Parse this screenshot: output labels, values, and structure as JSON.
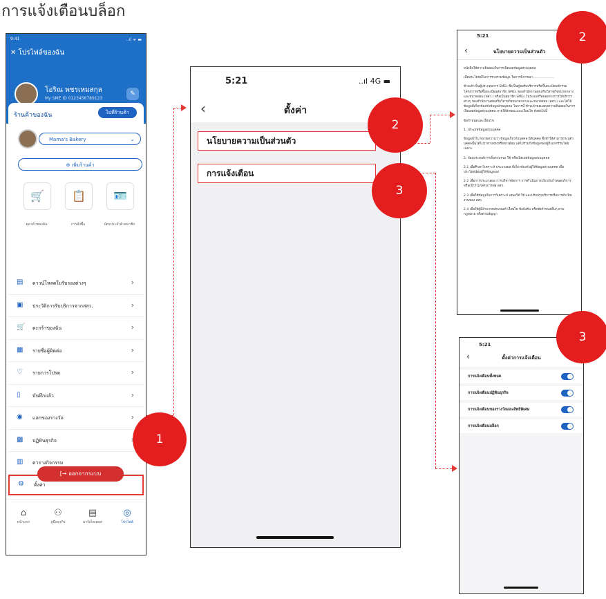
{
  "heading": "การแจ้งเตือนบล็อก",
  "screen1": {
    "status_time": "9:41",
    "status_right": "..ıl ᯤ ▬",
    "header": "✕ โปรไฟล์ของฉัน",
    "user_name": "โอริณ พชรเหมสกุล",
    "user_id": "My SME ID 0123456789123",
    "shop_section": "ร้านค้าของฉัน",
    "shop_button": "ไปที่ร้านค้า",
    "shop_name": "Mama's Bakery",
    "add_shop": "⊕ เพิ่มร้านค้า",
    "tiles": [
      {
        "icon": "cart-icon",
        "label": "ตุลาค้าของฉัน"
      },
      {
        "icon": "clipboard-icon",
        "label": "การสั่งซื้อ"
      },
      {
        "icon": "member-card-icon",
        "label": "บัตรประจำตัวสมาชิก"
      }
    ],
    "menu": [
      {
        "icon": "download-icon",
        "label": "ดาวน์โหลดใบรับรองต่างๆ"
      },
      {
        "icon": "history-icon",
        "label": "ประวัติการรับบริการจากสสว."
      },
      {
        "icon": "basket-icon",
        "label": "ตะกร้าของฉัน"
      },
      {
        "icon": "contact-icon",
        "label": "รายชื่อผู้ติดต่อ"
      },
      {
        "icon": "heart-icon",
        "label": "รายการโปรด"
      },
      {
        "icon": "bookmark-icon",
        "label": "บันทึกแล้ว"
      },
      {
        "icon": "gift-icon",
        "label": "แลกของรางวัล"
      },
      {
        "icon": "calendar-icon",
        "label": "ปฏิทินธุรกิจ"
      },
      {
        "icon": "activity-icon",
        "label": "ตารางกิจกรรม"
      },
      {
        "icon": "gear-icon",
        "label": "ตั้งค่า"
      }
    ],
    "logout": "[→ ออกจากระบบ",
    "tabs": [
      {
        "icon": "home-icon",
        "label": "หน้าแรก"
      },
      {
        "icon": "partner-icon",
        "label": "คู่มือธุรกิจ"
      },
      {
        "icon": "market-icon",
        "label": "มาร์เก็ตเพลส"
      },
      {
        "icon": "profile-icon",
        "label": "โปรไฟล์"
      }
    ]
  },
  "screen2": {
    "status_time": "5:21",
    "status_right": "..ıl 4G ▬",
    "title": "ตั้งค่า",
    "rows": [
      "นโยบายความเป็นส่วนตัว",
      "การแจ้งเตือน"
    ]
  },
  "screen3": {
    "status_time": "5:21",
    "title": "นโยบายความเป็นส่วนตัว",
    "paragraphs": [
      "หนังสือให้ความยินยอมในการเปิดเผยข้อมูลส่วนบุคคล",
      "เพื่อประโยชน์ในการรวบรวมข้อมูล ในการพิจารณา.....................",
      "ข้าพเจ้าเป็นผู้ประกอบการ SMEs ซึ่งเป็นผู้ขอรับบริการหรือขึ้นทะเบียนข้าร่วมโครงการหรือขึ้นทะเบียนสมาชิก SMEs ของสำนักงานส่งเสริมวิสาหกิจขนาดกลางและขนาดย่อม (สสว.) หรือเป็นสมาชิก SMEs ในระบบหรือของทางการให้บริการต่างๆ ของสำนักงานส่งเสริมวิสาหกิจขนาดกลางและขนาดย่อม (สสว.) และได้ให้ข้อมูลที่เกี่ยวข้องกับข้อมูลส่วนบุคคล ในการนี้ ข้าพเจ้าขอแสดงความยินยอมในการเปิดเผยข้อมูลส่วนบุคคล ภายใต้ลักษณะและเงื่อนไข ดังต่อไปนี้",
      "ข้อกำหนดและเงื่อนไข",
      "1. ประเภทข้อมูลส่วนบุคคล",
      "ข้อมูลทั่วไป หมายความว่า ข้อมูลเกี่ยวกับบุคคล นิติบุคคล ซึ่งทำให้สามารถระบุตัวบุคคลนั้นได้ไม่ว่าทางตรงหรือทางอ้อม แต่ไม่รวมถึงข้อมูลของผู้ถึงแก่กรรมโดยเฉพาะ",
      "2. วัตถุประสงค์การเก็บรวบรวม ใช้ หรือเปิดเผยข้อมูลส่วนบุคคล",
      "2.1 เพื่อศึกษาวิเคราะห์ ประมวลผล ที่เกี่ยวข้องกับผู้ให้ข้อมูลส่วนบุคคล เพื่อประโยชน์ต่อผู้ให้ข้อมูลเอง",
      "2.2 เพื่อการประมวลผล การบริหารจัดการ การดำเนินการเกี่ยวกับกำหนดบริการหรือเข้าร่วมโครงการต่อ สสว.",
      "2.3 เพื่อใช้ข้อมูลในการวิเคราะห์ เสนอให้ ใช้ และปรับปรุงบริการหรือการดำเนินงานของ สสว.",
      "2.4 เพื่อให้ผู้มีอำนาจหลักเกณฑ์ เงื่อนไข ข้อบังคับ หรือข้อกำหนดอื่นๆ ตามกฎหมาย หรือตามสัญญา"
    ]
  },
  "screen4": {
    "status_time": "5:21",
    "title": "ตั้งค่าการแจ้งเตือน",
    "toggles": [
      {
        "label": "การแจ้งเตือนทั้งหมด",
        "on": true
      },
      {
        "label": "การแจ้งเตือนปฏิทินธุรกิจ",
        "on": true
      },
      {
        "label": "การแจ้งเตือนของรางวัลและสิทธิพิเศษ",
        "on": true
      },
      {
        "label": "การแจ้งเตือนบล็อก",
        "on": true
      }
    ]
  },
  "badges": [
    "1",
    "2",
    "3",
    "2",
    "3"
  ],
  "colors": {
    "brand_blue": "#1e6fc8",
    "badge_red": "#e41e1e",
    "highlight_red": "#e53935"
  }
}
